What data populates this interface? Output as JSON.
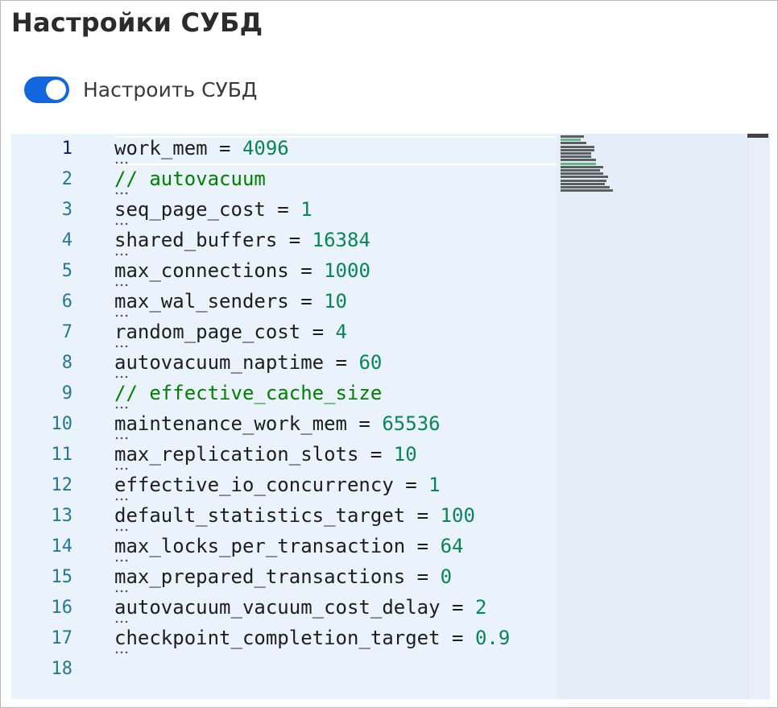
{
  "page": {
    "title": "Настройки СУБД"
  },
  "toggle": {
    "label": "Настроить СУБД",
    "checked": true,
    "accent": "#1266e0"
  },
  "editor": {
    "active_line": 1,
    "lines": [
      {
        "n": "1",
        "key": "work_mem",
        "op": " = ",
        "value": "4096",
        "comment": ""
      },
      {
        "n": "2",
        "key": "",
        "op": "",
        "value": "",
        "comment": "// autovacuum"
      },
      {
        "n": "3",
        "key": "seq_page_cost",
        "op": " = ",
        "value": "1",
        "comment": ""
      },
      {
        "n": "4",
        "key": "shared_buffers",
        "op": " = ",
        "value": "16384",
        "comment": ""
      },
      {
        "n": "5",
        "key": "max_connections",
        "op": " = ",
        "value": "1000",
        "comment": ""
      },
      {
        "n": "6",
        "key": "max_wal_senders",
        "op": " = ",
        "value": "10",
        "comment": ""
      },
      {
        "n": "7",
        "key": "random_page_cost",
        "op": " = ",
        "value": "4",
        "comment": ""
      },
      {
        "n": "8",
        "key": "autovacuum_naptime",
        "op": " = ",
        "value": "60",
        "comment": ""
      },
      {
        "n": "9",
        "key": "",
        "op": "",
        "value": "",
        "comment": "// effective_cache_size"
      },
      {
        "n": "10",
        "key": "maintenance_work_mem",
        "op": " = ",
        "value": "65536",
        "comment": ""
      },
      {
        "n": "11",
        "key": "max_replication_slots",
        "op": " = ",
        "value": "10",
        "comment": ""
      },
      {
        "n": "12",
        "key": "effective_io_concurrency",
        "op": " = ",
        "value": "1",
        "comment": ""
      },
      {
        "n": "13",
        "key": "default_statistics_target",
        "op": " = ",
        "value": "100",
        "comment": ""
      },
      {
        "n": "14",
        "key": "max_locks_per_transaction",
        "op": " = ",
        "value": "64",
        "comment": ""
      },
      {
        "n": "15",
        "key": "max_prepared_transactions",
        "op": " = ",
        "value": "0",
        "comment": ""
      },
      {
        "n": "16",
        "key": "autovacuum_vacuum_cost_delay",
        "op": " = ",
        "value": "2",
        "comment": ""
      },
      {
        "n": "17",
        "key": "checkpoint_completion_target",
        "op": " = ",
        "value": "0.9",
        "comment": ""
      },
      {
        "n": "18",
        "key": "",
        "op": "",
        "value": "",
        "comment": ""
      }
    ]
  },
  "colors": {
    "editor_bg": "#eaf2fc",
    "line_number": "#237893",
    "number_literal": "#098658",
    "comment": "#008000"
  }
}
